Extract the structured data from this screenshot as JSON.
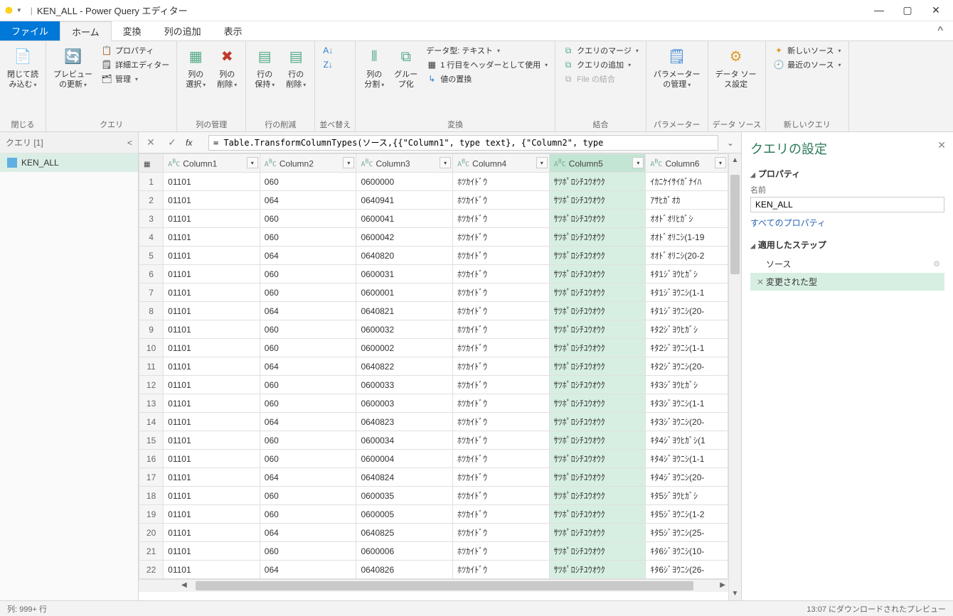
{
  "window": {
    "title": "KEN_ALL - Power Query エディター"
  },
  "tabs": {
    "file": "ファイル",
    "home": "ホーム",
    "transform": "変換",
    "addcol": "列の追加",
    "view": "表示"
  },
  "ribbon": {
    "close": "閉じて読\nみ込む",
    "refresh": "プレビュー\nの更新",
    "properties": "プロパティ",
    "adveditor": "詳細エディター",
    "manage": "管理",
    "g_query": "クエリ",
    "selcols": "列の\n選択",
    "remcols": "列の\n削除",
    "g_colmgmt": "列の管理",
    "keeprows": "行の\n保持",
    "remrows": "行の\n削除",
    "g_rowred": "行の削減",
    "sort_asc": "A↓Z",
    "sort_desc": "Z↓A",
    "g_sort": "並べ替え",
    "splitcol": "列の\n分割",
    "groupby": "グルー\nプ化",
    "datatype": "データ型: テキスト",
    "firstrow": "1 行目をヘッダーとして使用",
    "replace": "値の置換",
    "g_transform": "変換",
    "mergeq": "クエリのマージ",
    "appendq": "クエリの追加",
    "combinefile": "File の結合",
    "g_combine": "結合",
    "params": "パラメーター\nの管理",
    "g_params": "パラメーター",
    "dssettings": "データ ソー\nス設定",
    "g_datasource": "データ ソース",
    "newsource": "新しいソース",
    "recent": "最近のソース",
    "g_newquery": "新しいクエリ"
  },
  "queries": {
    "header": "クエリ [1]",
    "item": "KEN_ALL"
  },
  "formula": "= Table.TransformColumnTypes(ソース,{{\"Column1\", type text}, {\"Column2\", type",
  "columns": [
    "Column1",
    "Column2",
    "Column3",
    "Column4",
    "Column5",
    "Column6"
  ],
  "rows": [
    [
      "01101",
      "060",
      "0600000",
      "ﾎﾂｶｲﾄﾞｳ",
      "ｻﾂﾎﾟﾛｼﾁﾕｳｵｳｸ",
      "ｲｶﾆｹｲｻｲｶﾞﾅｲﾊ"
    ],
    [
      "01101",
      "064",
      "0640941",
      "ﾎﾂｶｲﾄﾞｳ",
      "ｻﾂﾎﾟﾛｼﾁﾕｳｵｳｸ",
      "ｱｻﾋｶﾞｵｶ"
    ],
    [
      "01101",
      "060",
      "0600041",
      "ﾎﾂｶｲﾄﾞｳ",
      "ｻﾂﾎﾟﾛｼﾁﾕｳｵｳｸ",
      "ｵｵﾄﾞｵﾘﾋｶﾞｼ"
    ],
    [
      "01101",
      "060",
      "0600042",
      "ﾎﾂｶｲﾄﾞｳ",
      "ｻﾂﾎﾟﾛｼﾁﾕｳｵｳｸ",
      "ｵｵﾄﾞｵﾘﾆｼ(1-19"
    ],
    [
      "01101",
      "064",
      "0640820",
      "ﾎﾂｶｲﾄﾞｳ",
      "ｻﾂﾎﾟﾛｼﾁﾕｳｵｳｸ",
      "ｵｵﾄﾞｵﾘﾆｼ(20-2"
    ],
    [
      "01101",
      "060",
      "0600031",
      "ﾎﾂｶｲﾄﾞｳ",
      "ｻﾂﾎﾟﾛｼﾁﾕｳｵｳｸ",
      "ｷﾀ1ｼﾞﾖｳﾋｶﾞｼ"
    ],
    [
      "01101",
      "060",
      "0600001",
      "ﾎﾂｶｲﾄﾞｳ",
      "ｻﾂﾎﾟﾛｼﾁﾕｳｵｳｸ",
      "ｷﾀ1ｼﾞﾖｳﾆｼ(1-1"
    ],
    [
      "01101",
      "064",
      "0640821",
      "ﾎﾂｶｲﾄﾞｳ",
      "ｻﾂﾎﾟﾛｼﾁﾕｳｵｳｸ",
      "ｷﾀ1ｼﾞﾖｳﾆｼ(20-"
    ],
    [
      "01101",
      "060",
      "0600032",
      "ﾎﾂｶｲﾄﾞｳ",
      "ｻﾂﾎﾟﾛｼﾁﾕｳｵｳｸ",
      "ｷﾀ2ｼﾞﾖｳﾋｶﾞｼ"
    ],
    [
      "01101",
      "060",
      "0600002",
      "ﾎﾂｶｲﾄﾞｳ",
      "ｻﾂﾎﾟﾛｼﾁﾕｳｵｳｸ",
      "ｷﾀ2ｼﾞﾖｳﾆｼ(1-1"
    ],
    [
      "01101",
      "064",
      "0640822",
      "ﾎﾂｶｲﾄﾞｳ",
      "ｻﾂﾎﾟﾛｼﾁﾕｳｵｳｸ",
      "ｷﾀ2ｼﾞﾖｳﾆｼ(20-"
    ],
    [
      "01101",
      "060",
      "0600033",
      "ﾎﾂｶｲﾄﾞｳ",
      "ｻﾂﾎﾟﾛｼﾁﾕｳｵｳｸ",
      "ｷﾀ3ｼﾞﾖｳﾋｶﾞｼ"
    ],
    [
      "01101",
      "060",
      "0600003",
      "ﾎﾂｶｲﾄﾞｳ",
      "ｻﾂﾎﾟﾛｼﾁﾕｳｵｳｸ",
      "ｷﾀ3ｼﾞﾖｳﾆｼ(1-1"
    ],
    [
      "01101",
      "064",
      "0640823",
      "ﾎﾂｶｲﾄﾞｳ",
      "ｻﾂﾎﾟﾛｼﾁﾕｳｵｳｸ",
      "ｷﾀ3ｼﾞﾖｳﾆｼ(20-"
    ],
    [
      "01101",
      "060",
      "0600034",
      "ﾎﾂｶｲﾄﾞｳ",
      "ｻﾂﾎﾟﾛｼﾁﾕｳｵｳｸ",
      "ｷﾀ4ｼﾞﾖｳﾋｶﾞｼ(1"
    ],
    [
      "01101",
      "060",
      "0600004",
      "ﾎﾂｶｲﾄﾞｳ",
      "ｻﾂﾎﾟﾛｼﾁﾕｳｵｳｸ",
      "ｷﾀ4ｼﾞﾖｳﾆｼ(1-1"
    ],
    [
      "01101",
      "064",
      "0640824",
      "ﾎﾂｶｲﾄﾞｳ",
      "ｻﾂﾎﾟﾛｼﾁﾕｳｵｳｸ",
      "ｷﾀ4ｼﾞﾖｳﾆｼ(20-"
    ],
    [
      "01101",
      "060",
      "0600035",
      "ﾎﾂｶｲﾄﾞｳ",
      "ｻﾂﾎﾟﾛｼﾁﾕｳｵｳｸ",
      "ｷﾀ5ｼﾞﾖｳﾋｶﾞｼ"
    ],
    [
      "01101",
      "060",
      "0600005",
      "ﾎﾂｶｲﾄﾞｳ",
      "ｻﾂﾎﾟﾛｼﾁﾕｳｵｳｸ",
      "ｷﾀ5ｼﾞﾖｳﾆｼ(1-2"
    ],
    [
      "01101",
      "064",
      "0640825",
      "ﾎﾂｶｲﾄﾞｳ",
      "ｻﾂﾎﾟﾛｼﾁﾕｳｵｳｸ",
      "ｷﾀ5ｼﾞﾖｳﾆｼ(25-"
    ],
    [
      "01101",
      "060",
      "0600006",
      "ﾎﾂｶｲﾄﾞｳ",
      "ｻﾂﾎﾟﾛｼﾁﾕｳｵｳｸ",
      "ｷﾀ6ｼﾞﾖｳﾆｼ(10-"
    ],
    [
      "01101",
      "064",
      "0640826",
      "ﾎﾂｶｲﾄﾞｳ",
      "ｻﾂﾎﾟﾛｼﾁﾕｳｵｳｸ",
      "ｷﾀ6ｼﾞﾖｳﾆｼ(26-"
    ]
  ],
  "settings": {
    "title": "クエリの設定",
    "prop_hdr": "プロパティ",
    "name_label": "名前",
    "name_value": "KEN_ALL",
    "allprops": "すべてのプロパティ",
    "steps_hdr": "適用したステップ",
    "step1": "ソース",
    "step2": "変更された型"
  },
  "status": {
    "left": "列: 999+ 行",
    "right": "13:07 にダウンロードされたプレビュー"
  }
}
